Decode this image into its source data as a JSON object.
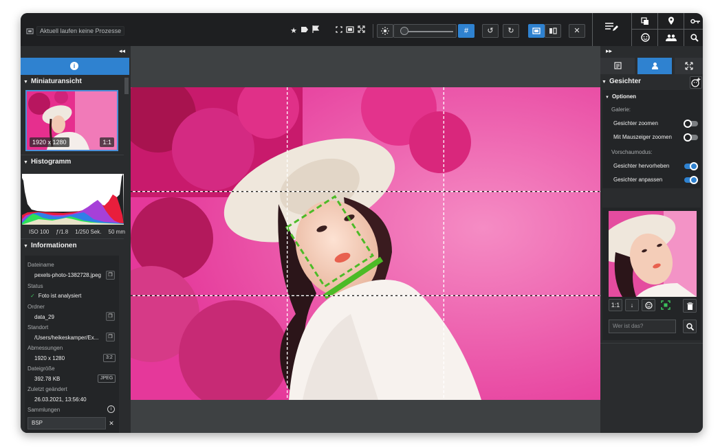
{
  "toolbar": {
    "process_status": "Aktuell laufen keine Prozesse",
    "icons": [
      "stamp-icon",
      "star-icon",
      "label-icon",
      "flag-icon",
      "crop-icon",
      "fit-icon",
      "fullscreen-icon",
      "brightness-icon",
      "grid-icon",
      "rotate-left-icon",
      "rotate-right-icon",
      "single-view-icon",
      "compare-view-icon",
      "close-icon",
      "edit-list-icon",
      "copy-icon",
      "location-icon",
      "key-icon",
      "face-icon",
      "people-icon",
      "search-icon"
    ],
    "zoom_level": 0.05,
    "accent": "#2f82d0"
  },
  "left": {
    "sections": {
      "thumbnail": "Miniaturansicht",
      "histogram": "Histogramm",
      "info": "Informationen"
    },
    "thumb_size": "1920 x 1280",
    "thumb_zoom": "1:1",
    "exif": {
      "iso": "ISO 100",
      "aperture": "ƒ/1.8",
      "shutter": "1/250 Sek.",
      "focal": "50 mm"
    },
    "fields": {
      "filename_label": "Dateiname",
      "filename": "pexels-photo-1382728.jpeg",
      "status_label": "Status",
      "status": "Foto ist analysiert",
      "folder_label": "Ordner",
      "folder": "data_29",
      "location_label": "Standort",
      "location": "/Users/heikeskamper/Ex...",
      "dimensions_label": "Abmessungen",
      "dimensions": "1920 x 1280",
      "ratio": "3:2",
      "filesize_label": "Dateigröße",
      "filesize": "392.78 KB",
      "format": "JPEG",
      "modified_label": "Zuletzt geändert",
      "modified": "26.03.2021, 13:56:40",
      "collections_label": "Sammlungen",
      "collection_value": "BSP"
    }
  },
  "right": {
    "section": "Gesichter",
    "options": "Optionen",
    "gallery_label": "Galerie:",
    "zoom_faces": "Gesichter zoomen",
    "zoom_pointer": "Mit Mauszeiger zoomen",
    "preview_label": "Vorschaumodus:",
    "highlight": "Gesichter hervorheben",
    "fit": "Gesichter anpassen",
    "toggles": {
      "zoom_faces": false,
      "zoom_pointer": false,
      "highlight": true,
      "fit": true
    },
    "face_zoom": "1:1",
    "who_placeholder": "Wer ist das?"
  }
}
